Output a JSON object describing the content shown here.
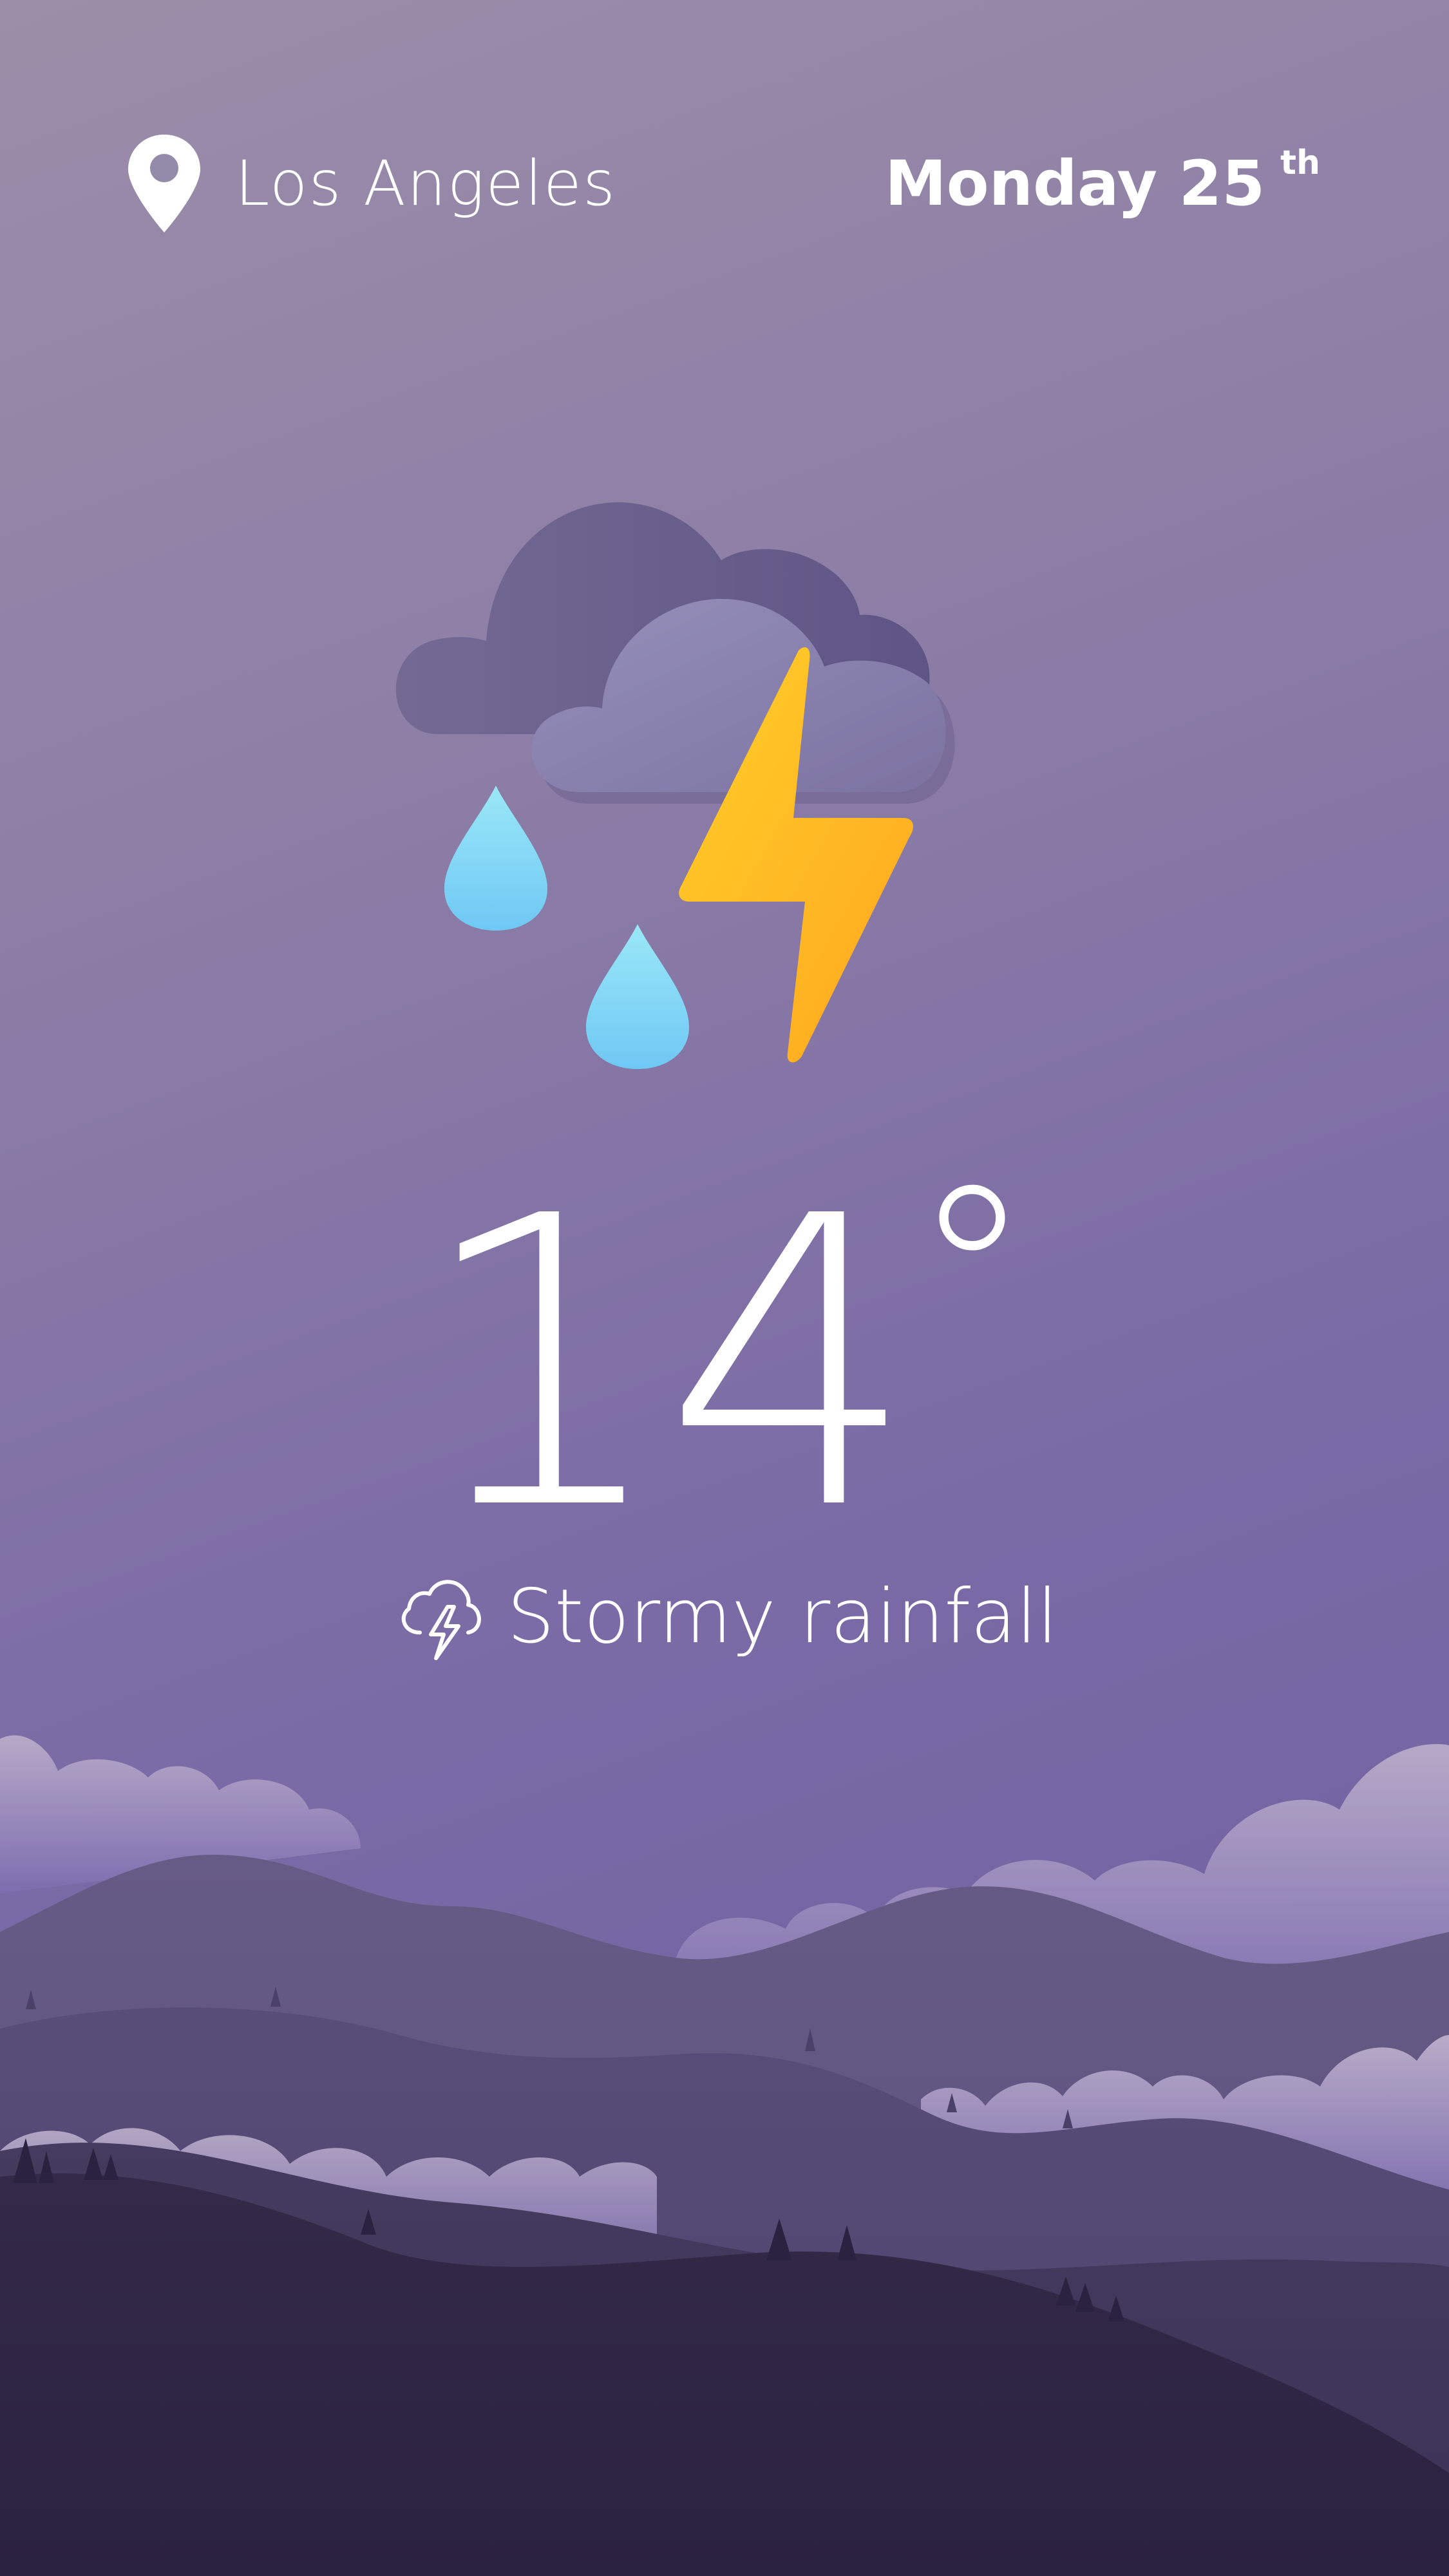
{
  "header": {
    "location_icon": "map-pin-icon",
    "location": "Los Angeles",
    "day": "Monday 25",
    "day_suffix": "th"
  },
  "weather": {
    "illustration": "storm-cloud-rain-lightning-icon",
    "temperature": "14",
    "unit": "°",
    "condition_icon": "cloud-lightning-icon",
    "condition": "Stormy rainfall"
  },
  "colors": {
    "background_top": "#9b8ea8",
    "background_bottom": "#6c5f9e",
    "lightning": "#ffb81f",
    "raindrop": "#79d6f5",
    "cloud_dark": "#6b6290",
    "cloud_light": "#8e86b3",
    "hills_dark": "#2e2540"
  }
}
